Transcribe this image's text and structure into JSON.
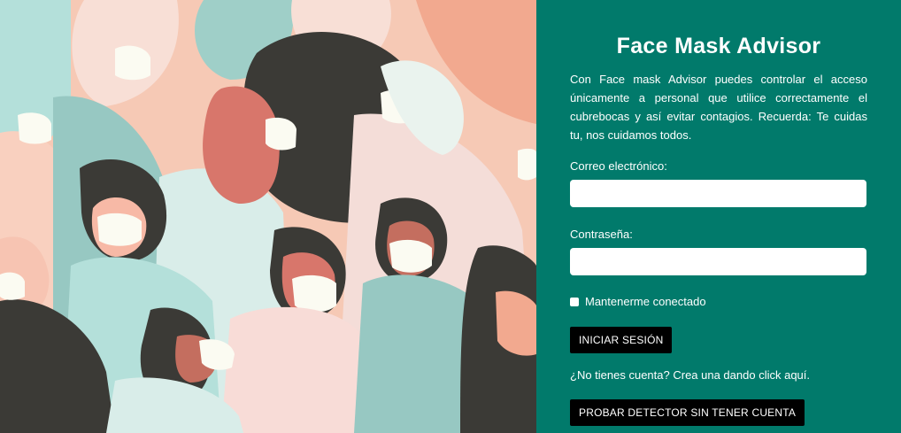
{
  "illustration": {
    "name": "people-with-face-masks"
  },
  "panel": {
    "title": "Face Mask Advisor",
    "description": "Con Face mask Advisor puedes controlar el acceso únicamente a personal que utilice correctamente el cubrebocas y así evitar contagios. Recuerda: Te cuidas tu, nos cuidamos todos.",
    "email_label": "Correo electrónico:",
    "email_value": "",
    "password_label": "Contraseña:",
    "password_value": "",
    "remember_label": "Mantenerme conectado",
    "login_button": "INICIAR SESIÓN",
    "signup_text": "¿No tienes cuenta? Crea una dando click aquí.",
    "try_button": "PROBAR DETECTOR SIN TENER CUENTA"
  },
  "colors": {
    "panel_bg": "#017a6b",
    "button_bg": "#000000"
  }
}
